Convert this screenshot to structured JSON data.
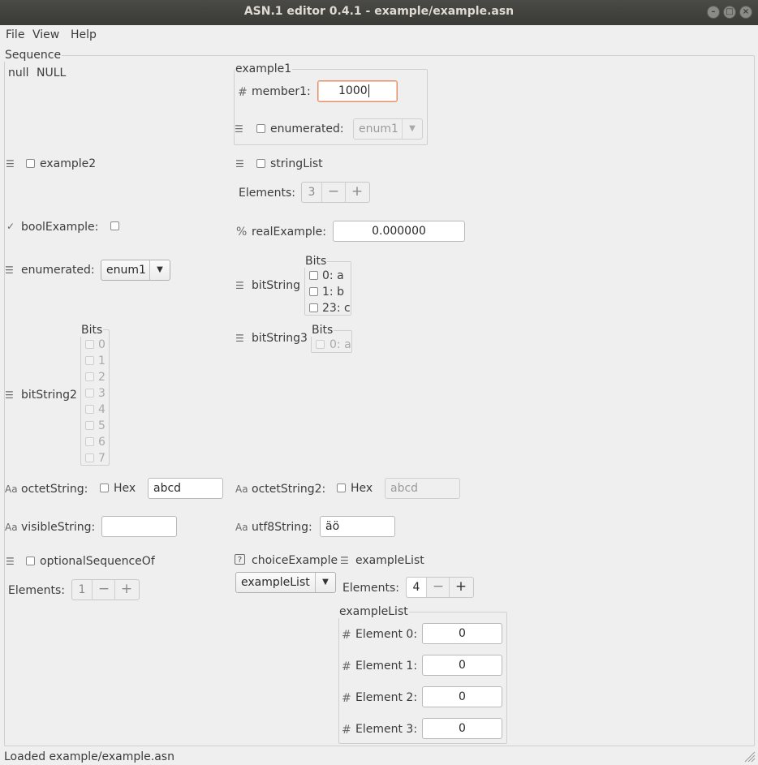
{
  "window": {
    "title": "ASN.1 editor 0.4.1 - example/example.asn"
  },
  "menu": [
    "File",
    "View",
    "Help"
  ],
  "root": {
    "title": "Sequence",
    "null_label": "null",
    "null_value": "NULL"
  },
  "example1": {
    "title": "example1",
    "member1_label": "member1:",
    "member1_value": "1000",
    "enumerated_label": "enumerated:",
    "enumerated_value": "enum1"
  },
  "example2": {
    "label": "example2"
  },
  "stringList": {
    "label": "stringList",
    "elements_label": "Elements:",
    "count": "3",
    "minus": "−",
    "plus": "+"
  },
  "boolExample": {
    "label": "boolExample:"
  },
  "realExample": {
    "label": "realExample:",
    "value": "0.000000"
  },
  "enumerated": {
    "label": "enumerated:",
    "value": "enum1"
  },
  "bitString": {
    "label": "bitString",
    "title": "Bits",
    "bits": [
      "0: a",
      "1: b",
      "23: c"
    ]
  },
  "bitString3": {
    "label": "bitString3",
    "title": "Bits",
    "bits": [
      "0: a"
    ]
  },
  "bitString2": {
    "label": "bitString2",
    "title": "Bits",
    "bits": [
      "0",
      "1",
      "2",
      "3",
      "4",
      "5",
      "6",
      "7"
    ]
  },
  "octetString": {
    "label": "octetString:",
    "hex_label": "Hex",
    "value": "abcd"
  },
  "octetString2": {
    "label": "octetString2:",
    "hex_label": "Hex",
    "value": "abcd"
  },
  "visibleString": {
    "label": "visibleString:",
    "value": ""
  },
  "utf8String": {
    "label": "utf8String:",
    "value": "äö"
  },
  "optionalSequenceOf": {
    "label": "optionalSequenceOf",
    "elements_label": "Elements:",
    "count": "1",
    "minus": "−",
    "plus": "+"
  },
  "choiceExample": {
    "label": "choiceExample",
    "value": "exampleList"
  },
  "exampleList": {
    "label": "exampleList",
    "elements_label": "Elements:",
    "count": "4",
    "minus": "−",
    "plus": "+",
    "title": "exampleList",
    "elements": [
      {
        "label": "Element 0:",
        "value": "0"
      },
      {
        "label": "Element 1:",
        "value": "0"
      },
      {
        "label": "Element 2:",
        "value": "0"
      },
      {
        "label": "Element 3:",
        "value": "0"
      }
    ]
  },
  "icons": {
    "number": "#",
    "real": "%",
    "string": "Aa",
    "list": "☰",
    "bool": "✓",
    "choice": "?"
  },
  "status": "Loaded example/example.asn"
}
